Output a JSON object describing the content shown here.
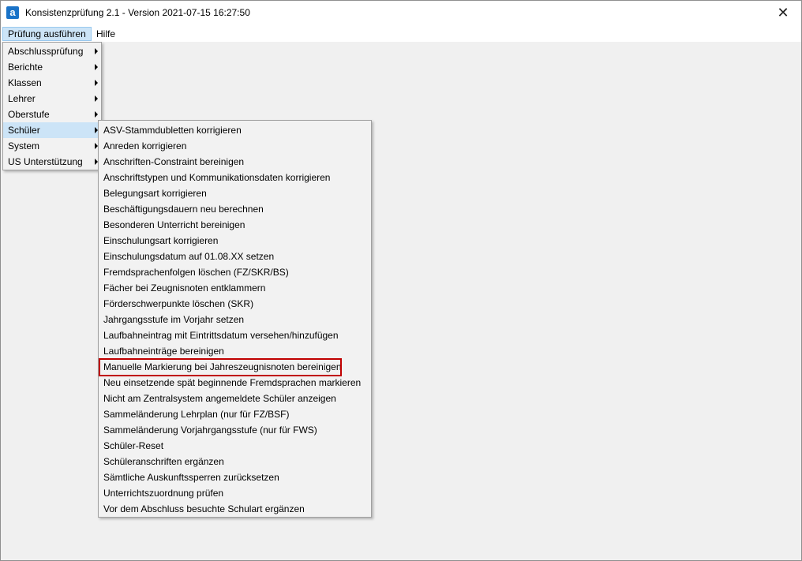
{
  "window": {
    "title": "Konsistenzprüfung 2.1 - Version 2021-07-15 16:27:50",
    "app_icon_letter": "a",
    "close_glyph": "✕"
  },
  "menubar": {
    "items": [
      {
        "label": "Prüfung ausführen"
      },
      {
        "label": "Hilfe"
      }
    ]
  },
  "main_menu": {
    "items": [
      {
        "label": "Abschlussprüfung"
      },
      {
        "label": "Berichte"
      },
      {
        "label": "Klassen"
      },
      {
        "label": "Lehrer"
      },
      {
        "label": "Oberstufe"
      },
      {
        "label": "Schüler"
      },
      {
        "label": "System"
      },
      {
        "label": "US Unterstützung"
      }
    ]
  },
  "submenu_schueler": {
    "items": [
      {
        "label": "ASV-Stammdubletten korrigieren"
      },
      {
        "label": "Anreden korrigieren"
      },
      {
        "label": "Anschriften-Constraint bereinigen"
      },
      {
        "label": "Anschriftstypen und Kommunikationsdaten korrigieren"
      },
      {
        "label": "Belegungsart korrigieren"
      },
      {
        "label": "Beschäftigungsdauern neu berechnen"
      },
      {
        "label": "Besonderen Unterricht bereinigen"
      },
      {
        "label": "Einschulungsart korrigieren"
      },
      {
        "label": "Einschulungsdatum auf 01.08.XX setzen"
      },
      {
        "label": "Fremdsprachenfolgen löschen (FZ/SKR/BS)"
      },
      {
        "label": "Fächer bei Zeugnisnoten entklammern"
      },
      {
        "label": "Förderschwerpunkte löschen (SKR)"
      },
      {
        "label": "Jahrgangsstufe im Vorjahr setzen"
      },
      {
        "label": "Laufbahneintrag mit Eintrittsdatum versehen/hinzufügen"
      },
      {
        "label": "Laufbahneinträge bereinigen"
      },
      {
        "label": "Manuelle Markierung bei Jahreszeugnisnoten bereinigen"
      },
      {
        "label": "Neu einsetzende spät beginnende Fremdsprachen markieren"
      },
      {
        "label": "Nicht am Zentralsystem angemeldete Schüler anzeigen"
      },
      {
        "label": "Sammeländerung Lehrplan (nur für FZ/BSF)"
      },
      {
        "label": "Sammeländerung Vorjahrgangsstufe (nur für FWS)"
      },
      {
        "label": "Schüler-Reset"
      },
      {
        "label": "Schüleranschriften ergänzen"
      },
      {
        "label": "Sämtliche Auskunftssperren zurücksetzen"
      },
      {
        "label": "Unterrichtszuordnung prüfen"
      },
      {
        "label": "Vor dem Abschluss besuchte Schulart ergänzen"
      }
    ]
  },
  "colors": {
    "hover": "#cce4f7",
    "highlight_border": "#c00000"
  }
}
